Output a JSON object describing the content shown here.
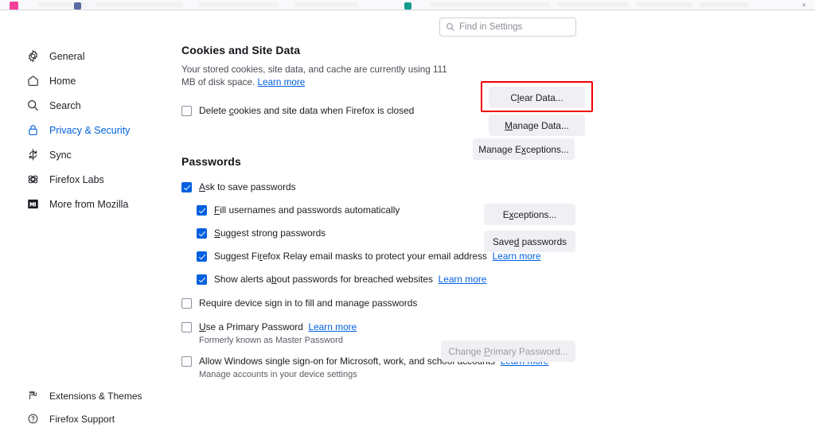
{
  "window": {
    "tabstrip_favicons": [
      "pink-favicon",
      "blue-favicon",
      "teal-favicon"
    ],
    "close_glyph": "×"
  },
  "search": {
    "placeholder": "Find in Settings",
    "value": "",
    "icon": "search-icon"
  },
  "sidebar": {
    "items": [
      {
        "label": "General",
        "icon": "gear-icon",
        "active": false
      },
      {
        "label": "Home",
        "icon": "home-icon",
        "active": false
      },
      {
        "label": "Search",
        "icon": "search-icon",
        "active": false
      },
      {
        "label": "Privacy & Security",
        "icon": "lock-icon",
        "active": true
      },
      {
        "label": "Sync",
        "icon": "sync-icon",
        "active": false
      },
      {
        "label": "Firefox Labs",
        "icon": "flask-atom-icon",
        "active": false
      },
      {
        "label": "More from Mozilla",
        "icon": "mozilla-m-icon",
        "active": false
      }
    ],
    "bottom_items": [
      {
        "label": "Extensions & Themes",
        "icon": "extensions-icon"
      },
      {
        "label": "Firefox Support",
        "icon": "question-circle-icon"
      }
    ]
  },
  "cookies_section": {
    "title": "Cookies and Site Data",
    "description": "Your stored cookies, site data, and cache are currently using 111 MB of disk space.",
    "learn_more": "Learn more",
    "storage_used": "111 MB",
    "delete_on_close": {
      "label_pre": "Delete ",
      "label_key": "c",
      "label_post": "ookies and site data when Firefox is closed",
      "checked": false
    },
    "buttons": [
      {
        "pre": "C",
        "key": "l",
        "post": "ear Data...",
        "name": "clear-data-button",
        "disabled": false
      },
      {
        "pre": "",
        "key": "M",
        "post": "anage Data...",
        "name": "manage-data-button",
        "disabled": false
      },
      {
        "pre": "Manage E",
        "key": "x",
        "post": "ceptions...",
        "name": "manage-exceptions-button",
        "disabled": false
      }
    ]
  },
  "passwords_section": {
    "title": "Passwords",
    "rows": [
      {
        "pre": "",
        "key": "A",
        "post": "sk to save passwords",
        "checked": true,
        "indent": false,
        "link": ""
      },
      {
        "pre": "",
        "key": "F",
        "post": "ill usernames and passwords automatically",
        "checked": true,
        "indent": true,
        "link": ""
      },
      {
        "pre": "",
        "key": "S",
        "post": "uggest strong passwords",
        "checked": true,
        "indent": true,
        "link": ""
      },
      {
        "pre": "Suggest Fi",
        "key": "r",
        "post": "efox Relay email masks to protect your email address",
        "checked": true,
        "indent": true,
        "link": "Learn more"
      },
      {
        "pre": "Show alerts a",
        "key": "b",
        "post": "out passwords for breached websites",
        "checked": true,
        "indent": true,
        "link": "Learn more"
      },
      {
        "pre": "Require device sign in to fill and manage passwords",
        "key": "",
        "post": "",
        "checked": false,
        "indent": false,
        "link": ""
      }
    ],
    "primary_password": {
      "pre": "",
      "key": "U",
      "post": "se a Primary Password",
      "checked": false,
      "link": "Learn more",
      "note": "Formerly known as Master Password"
    },
    "windows_sso": {
      "label": "Allow Windows single sign-on for Microsoft, work, and school accounts",
      "checked": false,
      "link": "Learn more",
      "note": "Manage accounts in your device settings"
    },
    "buttons": [
      {
        "pre": "E",
        "key": "x",
        "post": "ceptions...",
        "name": "password-exceptions-button",
        "disabled": false
      },
      {
        "pre": "Save",
        "key": "d",
        "post": " passwords",
        "name": "saved-passwords-button",
        "disabled": false
      },
      {
        "pre": "Change ",
        "key": "P",
        "post": "rimary Password...",
        "name": "change-primary-password-button",
        "disabled": true
      }
    ]
  },
  "colors": {
    "accent": "#0060df",
    "link": "#0060df",
    "highlight": "#f20000",
    "button_bg": "#f0f0f4"
  }
}
